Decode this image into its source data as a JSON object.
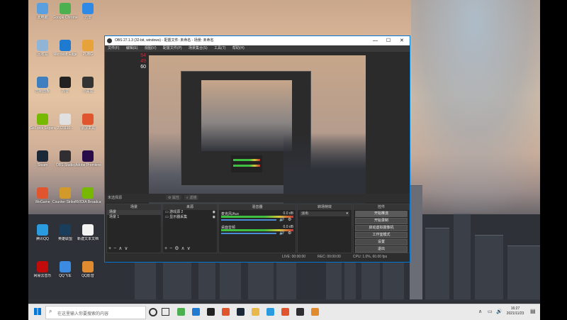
{
  "colors": {
    "accent": "#0078d7",
    "obs_bg": "#2b2b2b",
    "meter_green": "#3fbf3f"
  },
  "desktop": {
    "icons": [
      {
        "label": "此电脑",
        "icon": "computer-icon",
        "color": "#5aa0e0"
      },
      {
        "label": "回收站",
        "icon": "recycle-bin-icon",
        "color": "#8fb4d6"
      },
      {
        "label": "控制面板",
        "icon": "control-panel-icon",
        "color": "#3f7fbf"
      },
      {
        "label": "GeForce Experience",
        "icon": "geforce-icon",
        "color": "#76b900"
      },
      {
        "label": "Steam",
        "icon": "steam-icon",
        "color": "#1b2838"
      },
      {
        "label": "WeGame",
        "icon": "wegame-icon",
        "color": "#e0552e"
      },
      {
        "label": "腾讯QQ",
        "icon": "qq-icon",
        "color": "#2b9be0"
      },
      {
        "label": "网易云音乐",
        "icon": "music-icon",
        "color": "#c20c0c"
      },
      {
        "label": "Google Chrome",
        "icon": "chrome-icon",
        "color": "#4caf50"
      },
      {
        "label": "Microsoft Edge",
        "icon": "edge-icon",
        "color": "#1f7ad2"
      },
      {
        "label": "抖音",
        "icon": "douyin-icon",
        "color": "#222"
      },
      {
        "label": "2021110...",
        "icon": "video-file-icon",
        "color": "#e0e0e0"
      },
      {
        "label": "OBS Studio",
        "icon": "obs-icon",
        "color": "#302e31"
      },
      {
        "label": "Counter-Strike Global Off...",
        "icon": "csgo-icon",
        "color": "#d19a2a"
      },
      {
        "label": "英雄联盟",
        "icon": "lol-icon",
        "color": "#1a3d5c"
      },
      {
        "label": "QQ飞车",
        "icon": "qqspeed-icon",
        "color": "#3b8be0"
      },
      {
        "label": "迅雷",
        "icon": "thunder-icon",
        "color": "#2e8ae6"
      },
      {
        "label": "PUBG",
        "icon": "pubg-icon",
        "color": "#e8a23a"
      },
      {
        "label": "小黑盒",
        "icon": "heybox-icon",
        "color": "#333"
      },
      {
        "label": "录屏工具",
        "icon": "recorder-icon",
        "color": "#e0552e"
      },
      {
        "label": "Adobe Premiere Pro",
        "icon": "premiere-icon",
        "color": "#2a0b4a"
      },
      {
        "label": "NVIDIA Broadcast",
        "icon": "nvidia-icon",
        "color": "#76b900"
      },
      {
        "label": "新建文本文档",
        "icon": "text-file-icon",
        "color": "#f3f3f3"
      },
      {
        "label": "QQ影音",
        "icon": "qqplayer-icon",
        "color": "#e08b2e"
      }
    ]
  },
  "obs": {
    "title": "OBS 27.1.3 (32-bit, windows) - 配置文件: 未命名 - 场景: 未命名",
    "menu": [
      "文件(F)",
      "编辑(E)",
      "视图(V)",
      "配置文件(P)",
      "场景集合(S)",
      "工具(T)",
      "帮助(H)"
    ],
    "stats": [
      "54",
      "49",
      "60"
    ],
    "no_source_label": "未选择源",
    "properties_button": "属性",
    "filters_button": "滤镜",
    "docks": {
      "scenes": {
        "title": "场景",
        "items": [
          "场景",
          "场景 1"
        ]
      },
      "sources": {
        "title": "来源",
        "items": [
          "游戏源 2",
          "显示器采集"
        ]
      },
      "mixer": {
        "title": "混音器",
        "tracks": [
          {
            "name": "麦克风/Aux",
            "db": "0.0 dB"
          },
          {
            "name": "桌面音频",
            "db": "0.0 dB"
          }
        ]
      },
      "transitions": {
        "title": "转场特效",
        "value": "淡出",
        "duration_label": "时长",
        "duration": "300 ms"
      },
      "controls": {
        "title": "控件",
        "buttons": [
          "开始推流",
          "开始录制",
          "启动虚拟摄像机",
          "工作室模式",
          "设置",
          "退出"
        ]
      }
    },
    "status": {
      "live": "LIVE: 00:00:00",
      "rec": "REC: 00:00:00",
      "cpu": "CPU: 1.0%, 60.00 fps"
    }
  },
  "taskbar": {
    "search_placeholder": "在这里输入你要搜索的内容",
    "time": "16:27",
    "date": "2021/11/23"
  }
}
